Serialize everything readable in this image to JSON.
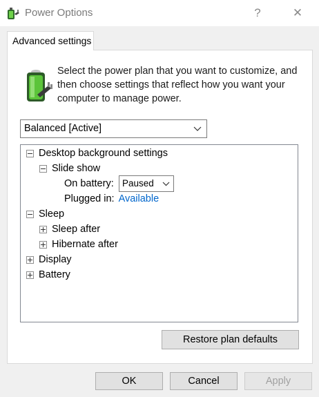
{
  "window": {
    "title": "Power Options",
    "help_label": "?",
    "close_label": "✕",
    "icon": "power-options-icon"
  },
  "tab": {
    "label": "Advanced settings"
  },
  "intro": {
    "icon": "battery-plug-icon",
    "text": "Select the power plan that you want to customize, and then choose settings that reflect how you want your computer to manage power."
  },
  "plan_select": {
    "value": "Balanced [Active]"
  },
  "tree": {
    "desktop_background": "Desktop background settings",
    "slide_show": "Slide show",
    "on_battery_label": "On battery:",
    "on_battery_value": "Paused",
    "plugged_in_label": "Plugged in:",
    "plugged_in_value": "Available",
    "sleep": "Sleep",
    "sleep_after": "Sleep after",
    "hibernate_after": "Hibernate after",
    "display": "Display",
    "battery": "Battery"
  },
  "buttons": {
    "restore": "Restore plan defaults",
    "ok": "OK",
    "cancel": "Cancel",
    "apply": "Apply"
  },
  "colors": {
    "link": "#0066cc",
    "battery_green": "#4caf2a"
  }
}
